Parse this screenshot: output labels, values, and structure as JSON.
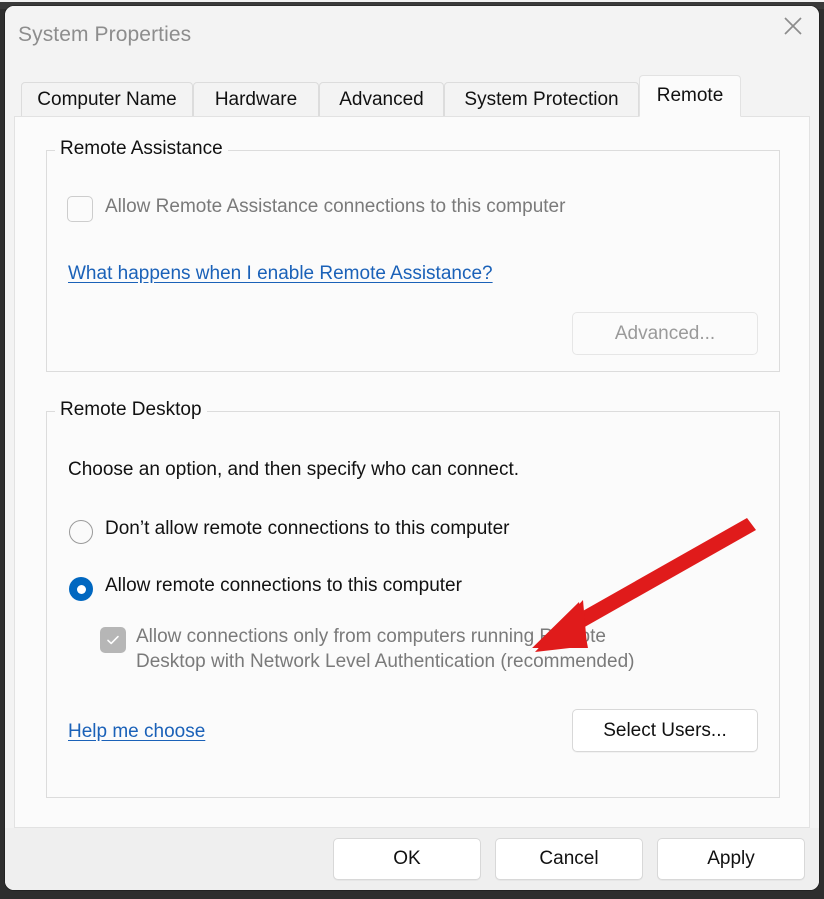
{
  "window": {
    "title": "System Properties",
    "close_icon": "close-icon"
  },
  "tabs": [
    {
      "label": "Computer Name",
      "active": false
    },
    {
      "label": "Hardware",
      "active": false
    },
    {
      "label": "Advanced",
      "active": false
    },
    {
      "label": "System Protection",
      "active": false
    },
    {
      "label": "Remote",
      "active": true
    }
  ],
  "remote_assistance": {
    "legend": "Remote Assistance",
    "allow_checkbox_label": "Allow Remote Assistance connections to this computer",
    "allow_checkbox_checked": false,
    "allow_checkbox_enabled": false,
    "help_link": "What happens when I enable Remote Assistance?",
    "advanced_button": "Advanced...",
    "advanced_button_enabled": false
  },
  "remote_desktop": {
    "legend": "Remote Desktop",
    "description": "Choose an option, and then specify who can connect.",
    "options": [
      {
        "label": "Don’t allow remote connections to this computer",
        "selected": false
      },
      {
        "label": "Allow remote connections to this computer",
        "selected": true
      }
    ],
    "nla_checkbox_line1": "Allow connections only from computers running Remote",
    "nla_checkbox_line2": "Desktop with Network Level Authentication (recommended)",
    "nla_checkbox_checked": true,
    "nla_checkbox_enabled": false,
    "help_link": "Help me choose",
    "select_users_button": "Select Users...",
    "select_users_enabled": true
  },
  "footer": {
    "ok_label": "OK",
    "cancel_label": "Cancel",
    "apply_label": "Apply"
  },
  "annotation": {
    "type": "red-arrow",
    "color": "#e01b1b",
    "points_to": "nla-checkbox"
  },
  "colors": {
    "accent": "#0067c0",
    "link": "#1a61b8",
    "disabled_text": "#7a7a7a",
    "annotation_red": "#e01b1b",
    "dialog_bg": "#f3f3f3",
    "panel_bg": "#fbfbfb"
  }
}
